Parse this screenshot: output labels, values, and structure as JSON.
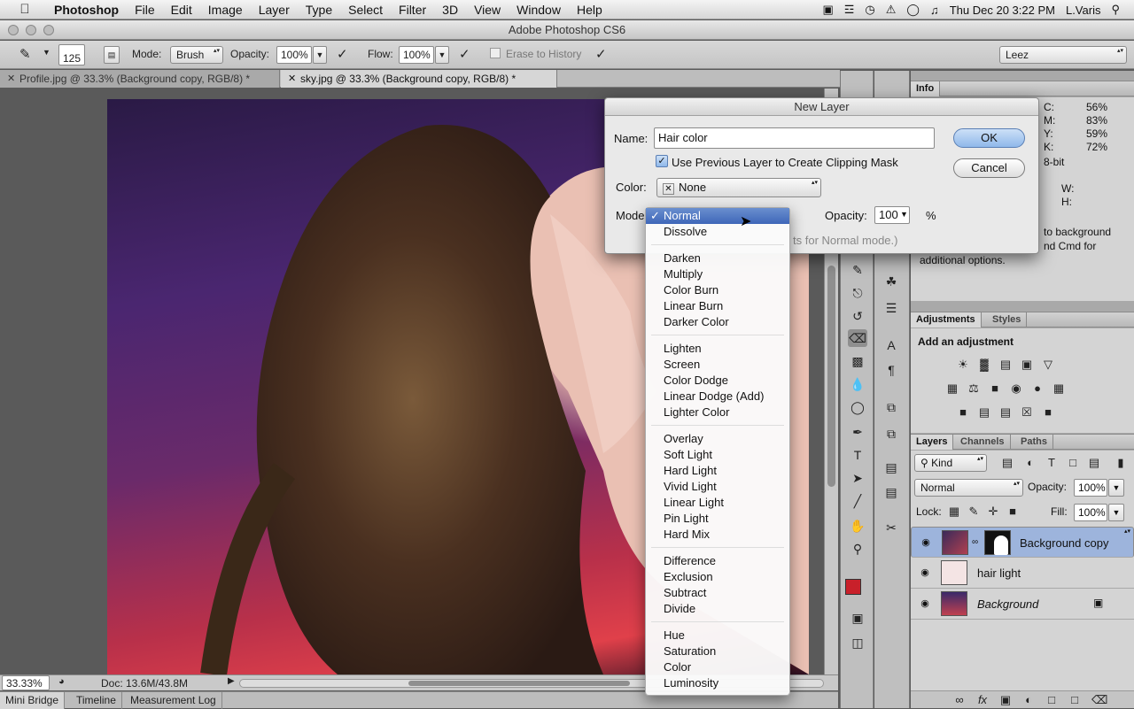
{
  "menubar": {
    "app": "Photoshop",
    "items": [
      "File",
      "Edit",
      "Image",
      "Layer",
      "Type",
      "Select",
      "Filter",
      "3D",
      "View",
      "Window",
      "Help"
    ],
    "clock": "Thu Dec 20  3:22 PM",
    "user": "L.Varis"
  },
  "window": {
    "title": "Adobe Photoshop CS6"
  },
  "options": {
    "brush_size": "125",
    "mode_label": "Mode:",
    "mode_value": "Brush",
    "opacity_label": "Opacity:",
    "opacity_value": "100%",
    "flow_label": "Flow:",
    "flow_value": "100%",
    "erase_history": "Erase to History",
    "workspace": "Leez"
  },
  "tabs": [
    {
      "label": "Profile.jpg @ 33.3% (Background copy, RGB/8) *"
    },
    {
      "label": "sky.jpg @ 33.3% (Background copy, RGB/8) *"
    }
  ],
  "status": {
    "zoom": "33.33%",
    "doc": "Doc: 13.6M/43.8M"
  },
  "bottom_tabs": [
    "Mini Bridge",
    "Timeline",
    "Measurement Log"
  ],
  "info": {
    "tab": "Info",
    "c_label": "C:",
    "c": "56%",
    "m_label": "M:",
    "m": "83%",
    "y_label": "Y:",
    "y": "59%",
    "k_label": "K:",
    "k": "72%",
    "bit": "8-bit",
    "w": "W:",
    "h": "H:",
    "hint1": "to background",
    "hint2": "nd Cmd for",
    "hint3": "additional options."
  },
  "adjustments": {
    "tab1": "Adjustments",
    "tab2": "Styles",
    "heading": "Add an adjustment"
  },
  "layers_panel": {
    "tab1": "Layers",
    "tab2": "Channels",
    "tab3": "Paths",
    "kind": "Kind",
    "blend": "Normal",
    "opacity_label": "Opacity:",
    "opacity": "100%",
    "lock_label": "Lock:",
    "fill_label": "Fill:",
    "fill": "100%",
    "layers": [
      {
        "name": "Background copy",
        "selected": true
      },
      {
        "name": "hair light",
        "selected": false
      },
      {
        "name": "Background",
        "selected": false
      }
    ]
  },
  "dialog": {
    "title": "New Layer",
    "name_label": "Name:",
    "name_value": "Hair color",
    "clip_label": "Use Previous Layer to Create Clipping Mask",
    "color_label": "Color:",
    "color_value": "None",
    "mode_label": "Mode",
    "opacity_label": "Opacity:",
    "opacity_value": "100",
    "pct": "%",
    "hint": "ts for Normal mode.)",
    "ok": "OK",
    "cancel": "Cancel"
  },
  "blend_menu": {
    "groups": [
      [
        "Normal",
        "Dissolve"
      ],
      [
        "Darken",
        "Multiply",
        "Color Burn",
        "Linear Burn",
        "Darker Color"
      ],
      [
        "Lighten",
        "Screen",
        "Color Dodge",
        "Linear Dodge (Add)",
        "Lighter Color"
      ],
      [
        "Overlay",
        "Soft Light",
        "Hard Light",
        "Vivid Light",
        "Linear Light",
        "Pin Light",
        "Hard Mix"
      ],
      [
        "Difference",
        "Exclusion",
        "Subtract",
        "Divide"
      ],
      [
        "Hue",
        "Saturation",
        "Color",
        "Luminosity"
      ]
    ],
    "selected": "Normal",
    "check": "✓"
  },
  "colors": {
    "foreground": "#c8202a",
    "background": "#2a4cc8",
    "selection": "#9db4dc"
  }
}
